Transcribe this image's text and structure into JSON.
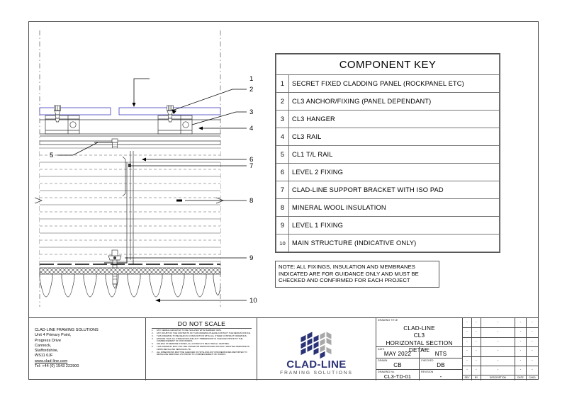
{
  "component_key": {
    "header": "COMPONENT KEY",
    "rows": [
      {
        "num": "1",
        "label": "SECRET FIXED CLADDING PANEL (ROCKPANEL ETC)"
      },
      {
        "num": "2",
        "label": "CL3 ANCHOR/FIXING (PANEL DEPENDANT)"
      },
      {
        "num": "3",
        "label": "CL3 HANGER"
      },
      {
        "num": "4",
        "label": "CL3 RAIL"
      },
      {
        "num": "5",
        "label": "CL1 T/L RAIL"
      },
      {
        "num": "6",
        "label": "LEVEL 2 FIXING"
      },
      {
        "num": "7",
        "label": "CLAD-LINE SUPPORT BRACKET WITH ISO PAD"
      },
      {
        "num": "8",
        "label": "MINERAL WOOL INSULATION"
      },
      {
        "num": "9",
        "label": "LEVEL 1 FIXING"
      },
      {
        "num": "10",
        "label": "MAIN STRUCTURE (INDICATIVE ONLY)"
      }
    ]
  },
  "note_box": {
    "line1": "NOTE: ALL FIXINGS, INSULATION AND MEMBRANES",
    "line2": "INDICATED ARE FOR GUIDANCE ONLY AND MUST BE",
    "line3": "CHECKED AND CONFIRMED FOR EACH PROJECT"
  },
  "drawing_callouts": [
    "1",
    "2",
    "3",
    "4",
    "5",
    "6",
    "7",
    "8",
    "9",
    "10"
  ],
  "company": {
    "name": "CLAD-LINE FRAMING SOLUTIONS",
    "address1": "Unit 4 Primary Point,",
    "address2": "Progress Drive",
    "address3": "Cannock,",
    "address4": "Staffordshire,",
    "postcode": "WS11 0JF",
    "website": "www.clad-line.com",
    "telephone": "Tel: +44 (0) 1543 222900"
  },
  "notes": {
    "heading": "DO NOT SCALE",
    "items": [
      {
        "n": "1.",
        "t": "ANY CEDRAL/ARCHITEX TO BE ISOLATED WITH BARRIER TAPE."
      },
      {
        "n": "2.",
        "t": "ANY DOUBT OF THE CONTENTS OF THIS DRAWING PLEASE CONTACT THE DESIGN OFFICE."
      },
      {
        "n": "3.",
        "t": "THIS DRAWING TO BE READ IN CONJUNCTION WITH ALL OTHER CONTRACT DRAWINGS."
      },
      {
        "n": "4.",
        "t": "ENSURE THAT ALL STEELWORK AND ANY TIMBERWORK IS CHECKED PRIOR TO THE COMMENCEMENT OF OUR WORKS."
      },
      {
        "n": "5.",
        "t": "UNLESS OTHERWISE STATED, ALL FIXINGS TO BE AT 600mm CENTRES."
      },
      {
        "n": "6.",
        "t": "THIS DRAWING MUST NOT BE COPIED OR REPRODUCED WITHOUT WRITTEN PERMISSION FROM METALLINE SERVICES LTD."
      },
      {
        "n": "7.",
        "t": "ALL DIMENSIONS MUST BE CHECKED ON SITE AND ANY DISCREPANCIES REPORTED TO METALLINE SERVICES LTD PRIOR TO COMMENCEMENT OF WORKS."
      }
    ]
  },
  "logo": {
    "name": "CLAD-LINE",
    "tagline": "FRAMING SOLUTIONS",
    "color_primary": "#2b3377",
    "color_secondary": "#a8a8a8"
  },
  "title_block": {
    "drawing_title_label": "DRAWING TITLE",
    "title_line1": "CLAD-LINE",
    "title_line2": "CL3",
    "title_line3": "HORIZONTAL SECTION DETAIL",
    "date_label": "DATE",
    "date_value": "MAY 2022",
    "scale_label": "SCALE",
    "scale_value": "NTS",
    "drawn_label": "DRAWN",
    "drawn_value": "CB",
    "checked_label": "CHECKED",
    "checked_value": "DB",
    "drawing_no_label": "DRAWING No.",
    "drawing_no_value": "CL3-TD-01",
    "revision_label": "REVISION",
    "revision_value": "-"
  },
  "revision_table": {
    "headers": [
      "REV",
      "BY",
      "DESCRIPTION",
      "DATE",
      "CHKD"
    ],
    "empty_mark": "-",
    "rows": 6
  }
}
